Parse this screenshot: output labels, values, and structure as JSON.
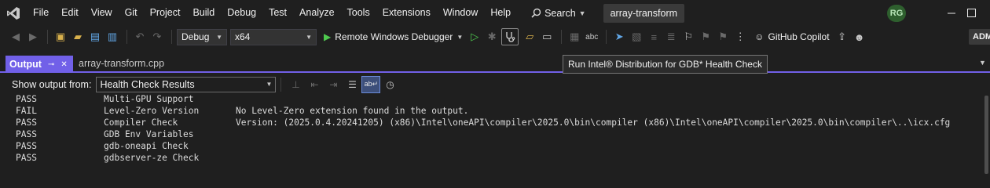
{
  "titlebar": {
    "menu": [
      "File",
      "Edit",
      "View",
      "Git",
      "Project",
      "Build",
      "Debug",
      "Test",
      "Analyze",
      "Tools",
      "Extensions",
      "Window",
      "Help"
    ],
    "search_label": "Search",
    "solution_name": "array-transform",
    "user_initials": "RG"
  },
  "toolbar": {
    "configuration": "Debug",
    "platform": "x64",
    "debugger_label": "Remote Windows Debugger",
    "copilot_label": "GitHub Copilot",
    "admin_badge": "ADM"
  },
  "tooltip": "Run Intel® Distribution for GDB* Health Check",
  "tabs": {
    "active": "Output",
    "document": "array-transform.cpp"
  },
  "output_panel": {
    "show_from_label": "Show output from:",
    "source": "Health Check Results",
    "lines": [
      {
        "status": "PASS",
        "check": "Multi-GPU Support",
        "message": ""
      },
      {
        "status": "FAIL",
        "check": "Level-Zero Version",
        "message": "No Level-Zero extension found in the output."
      },
      {
        "status": "PASS",
        "check": "Compiler Check",
        "message": "Version: (2025.0.4.20241205) (x86)\\Intel\\oneAPI\\compiler\\2025.0\\bin\\compiler (x86)\\Intel\\oneAPI\\compiler\\2025.0\\bin\\compiler\\..\\icx.cfg"
      },
      {
        "status": "PASS",
        "check": "GDB Env Variables",
        "message": ""
      },
      {
        "status": "PASS",
        "check": "gdb-oneapi Check",
        "message": ""
      },
      {
        "status": "PASS",
        "check": "gdbserver-ze Check",
        "message": ""
      }
    ]
  }
}
